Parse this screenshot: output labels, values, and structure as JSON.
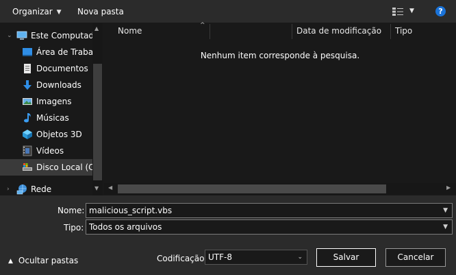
{
  "toolbar": {
    "organize_label": "Organizar",
    "new_folder_label": "Nova pasta",
    "view_icon": "view-options-icon",
    "help_icon": "help-icon",
    "help_glyph": "?"
  },
  "nav": {
    "items": [
      {
        "label": "Este Computado",
        "icon": "computer-icon"
      },
      {
        "label": "Área de Trabalh",
        "icon": "desktop-icon"
      },
      {
        "label": "Documentos",
        "icon": "documents-icon"
      },
      {
        "label": "Downloads",
        "icon": "downloads-icon"
      },
      {
        "label": "Imagens",
        "icon": "images-icon"
      },
      {
        "label": "Músicas",
        "icon": "music-icon"
      },
      {
        "label": "Objetos 3D",
        "icon": "objects-3d-icon"
      },
      {
        "label": "Vídeos",
        "icon": "videos-icon"
      },
      {
        "label": "Disco Local (C:)",
        "icon": "local-disk-icon",
        "selected": true
      },
      {
        "label": "Rede",
        "icon": "network-icon"
      }
    ]
  },
  "columns": {
    "name": "Nome",
    "modified": "Data de modificação",
    "type": "Tipo"
  },
  "empty_message": "Nenhum item corresponde à pesquisa.",
  "form": {
    "filename_label": "Nome:",
    "filename_value": "malicious_script.vbs",
    "filetype_label": "Tipo:",
    "filetype_value": "Todos os arquivos",
    "encoding_label": "Codificação:",
    "encoding_value": "UTF-8"
  },
  "buttons": {
    "save": "Salvar",
    "cancel": "Cancelar",
    "hide_folders": "Ocultar pastas"
  },
  "colors": {
    "background": "#191919",
    "toolbar": "#2b2b2b",
    "accent": "#1a73d9"
  }
}
